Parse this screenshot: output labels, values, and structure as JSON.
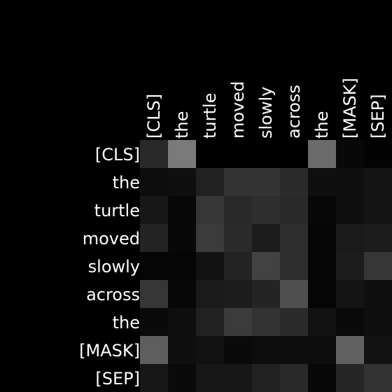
{
  "chart_data": {
    "type": "heatmap",
    "title": "",
    "xlabel": "",
    "ylabel": "",
    "x_tokens": [
      "[CLS]",
      "the",
      "turtle",
      "moved",
      "slowly",
      "across",
      "the",
      "[MASK]",
      "[SEP]"
    ],
    "y_tokens": [
      "[CLS]",
      "the",
      "turtle",
      "moved",
      "slowly",
      "across",
      "the",
      "[MASK]",
      "[SEP]"
    ],
    "colormap": "grayscale",
    "value_range": [
      0,
      1
    ],
    "grid": false,
    "values": [
      [
        0.16,
        0.48,
        0.0,
        0.0,
        0.0,
        0.0,
        0.42,
        0.03,
        0.01
      ],
      [
        0.05,
        0.06,
        0.13,
        0.2,
        0.2,
        0.17,
        0.06,
        0.06,
        0.08
      ],
      [
        0.09,
        0.03,
        0.21,
        0.16,
        0.18,
        0.16,
        0.03,
        0.06,
        0.08
      ],
      [
        0.14,
        0.03,
        0.23,
        0.17,
        0.11,
        0.18,
        0.02,
        0.1,
        0.11
      ],
      [
        0.02,
        0.02,
        0.07,
        0.14,
        0.26,
        0.18,
        0.02,
        0.11,
        0.21
      ],
      [
        0.21,
        0.03,
        0.1,
        0.11,
        0.14,
        0.31,
        0.02,
        0.08,
        0.06
      ],
      [
        0.04,
        0.06,
        0.13,
        0.23,
        0.2,
        0.17,
        0.07,
        0.04,
        0.06
      ],
      [
        0.37,
        0.06,
        0.07,
        0.04,
        0.05,
        0.05,
        0.05,
        0.38,
        0.07
      ],
      [
        0.09,
        0.04,
        0.09,
        0.09,
        0.13,
        0.16,
        0.03,
        0.15,
        0.2
      ]
    ]
  }
}
